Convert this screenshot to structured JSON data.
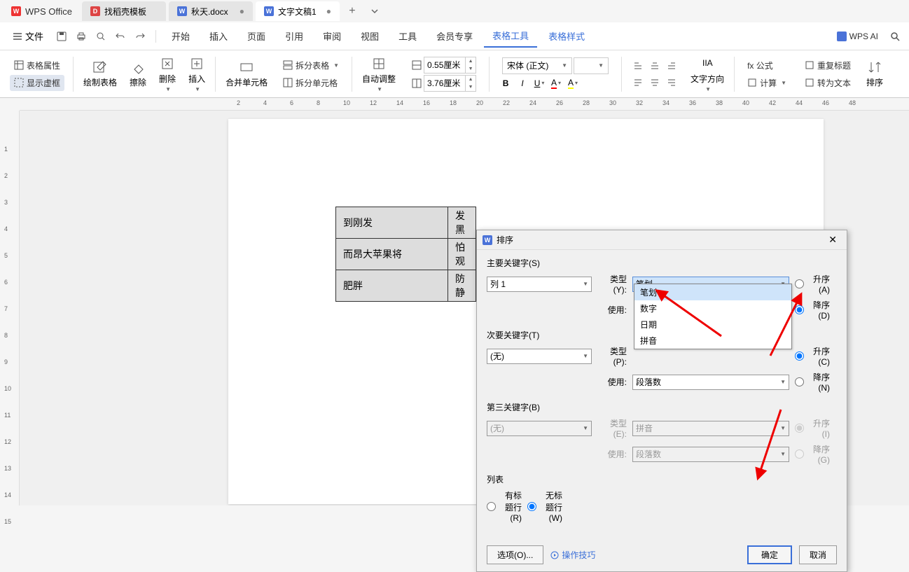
{
  "app": {
    "name": "WPS Office"
  },
  "tabs": [
    {
      "label": "找稻壳模板",
      "icon": "D"
    },
    {
      "label": "秋天.docx",
      "icon": "W",
      "modified": true
    },
    {
      "label": "文字文稿1",
      "icon": "W",
      "modified": true,
      "active": true
    }
  ],
  "menu": {
    "file": "文件",
    "items": [
      "开始",
      "插入",
      "页面",
      "引用",
      "审阅",
      "视图",
      "工具",
      "会员专享"
    ],
    "active": "表格工具",
    "sub": "表格样式",
    "ai": "WPS AI"
  },
  "ribbon": {
    "table_props": "表格属性",
    "show_grid": "显示虚框",
    "draw_table": "绘制表格",
    "erase": "擦除",
    "delete": "删除",
    "insert": "插入",
    "merge": "合并单元格",
    "split_table": "拆分表格",
    "split_cell": "拆分单元格",
    "autofit": "自动调整",
    "height": "0.55厘米",
    "width": "3.76厘米",
    "font": "宋体 (正文)",
    "font_size": "",
    "text_dir": "文字方向",
    "formula": "fx 公式",
    "calc": "计算",
    "repeat_header": "重复标题",
    "to_text": "转为文本",
    "sort": "排序"
  },
  "table": {
    "rows": [
      [
        "到刚发",
        "发黑"
      ],
      [
        "而昂大苹果将",
        "怕观"
      ],
      [
        "肥胖",
        "防静"
      ]
    ]
  },
  "dialog": {
    "title": "排序",
    "primary_label": "主要关键字(S)",
    "secondary_label": "次要关键字(T)",
    "third_label": "第三关键字(B)",
    "type_label_y": "类型(Y):",
    "type_label_p": "类型(P):",
    "type_label_e": "类型(E):",
    "use_label": "使用:",
    "col1": "列 1",
    "none": "(无)",
    "stroke": "笔划",
    "pinyin": "拼音",
    "para": "段落数",
    "asc_a": "升序(A)",
    "desc_d": "降序(D)",
    "asc_c": "升序(C)",
    "desc_n": "降序(N)",
    "asc_i": "升序(I)",
    "desc_g": "降序(G)",
    "list_label": "列表",
    "has_header": "有标题行(R)",
    "no_header": "无标题行(W)",
    "options": "选项(O)...",
    "tips": "操作技巧",
    "ok": "确定",
    "cancel": "取消"
  },
  "dropdown": {
    "items": [
      "笔划",
      "数字",
      "日期",
      "拼音"
    ]
  },
  "ruler_h": [
    2,
    4,
    6,
    8,
    10,
    12,
    14,
    16,
    18,
    20,
    22,
    24,
    26,
    28,
    30,
    32,
    34,
    36,
    38,
    40,
    42,
    44,
    46,
    48
  ],
  "ruler_v": [
    1,
    2,
    3,
    4,
    5,
    6,
    7,
    8,
    9,
    10,
    11,
    12,
    13,
    14,
    15
  ]
}
